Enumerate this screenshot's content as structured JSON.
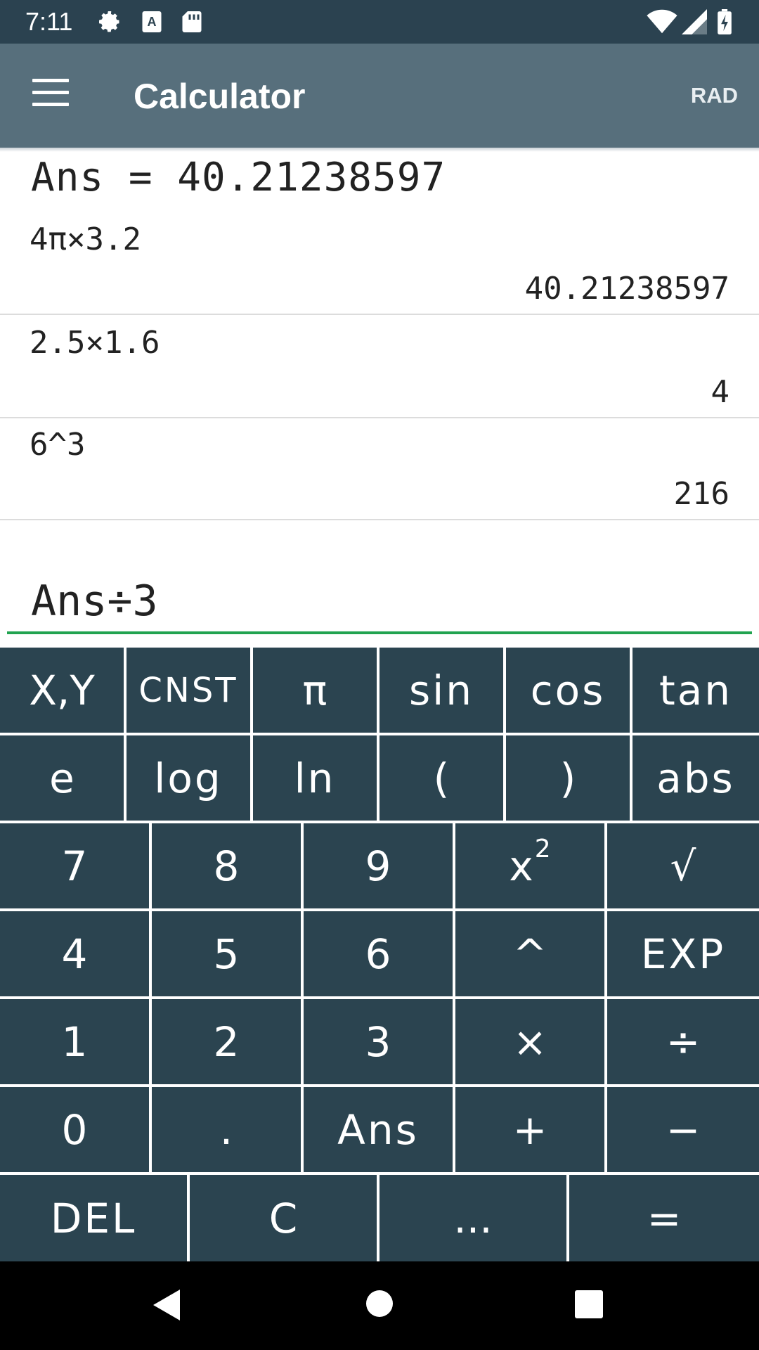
{
  "status_bar": {
    "time": "7:11",
    "icons": [
      "gear-icon",
      "a-keyboard-icon",
      "sd-card-icon",
      "wifi-icon",
      "signal-icon",
      "battery-charging-icon"
    ]
  },
  "app_bar": {
    "title": "Calculator",
    "mode": "RAD",
    "menu_icon": "hamburger-menu-icon"
  },
  "display": {
    "answer_line": "Ans = 40.21238597",
    "history": [
      {
        "expression": "4π×3.2",
        "result": "40.21238597"
      },
      {
        "expression": "2.5×1.6",
        "result": "4"
      },
      {
        "expression": "6^3",
        "result": "216"
      }
    ],
    "input": "Ans÷3"
  },
  "keypad": {
    "row1": [
      "X,Y",
      "CNST",
      "π",
      "sin",
      "cos",
      "tan"
    ],
    "row2": [
      "e",
      "log",
      "ln",
      "(",
      ")",
      "abs"
    ],
    "row3": [
      "7",
      "8",
      "9",
      "x",
      "√"
    ],
    "row3_superscript": "2",
    "row4": [
      "4",
      "5",
      "6",
      "^",
      "EXP"
    ],
    "row5": [
      "1",
      "2",
      "3",
      "×",
      "÷"
    ],
    "row6": [
      "0",
      ".",
      "Ans",
      "+",
      "−"
    ],
    "row7": [
      "DEL",
      "C",
      "...",
      "="
    ]
  },
  "nav_bar": {
    "icons": [
      "back-icon",
      "home-icon",
      "recents-icon"
    ]
  },
  "colors": {
    "status_bar": "#2b4250",
    "app_bar": "#576f7c",
    "key_background": "#2b4450",
    "input_underline": "#21a350"
  }
}
